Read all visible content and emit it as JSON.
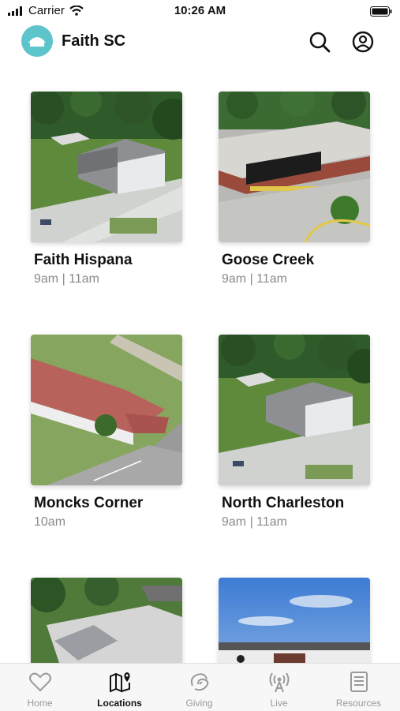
{
  "status_bar": {
    "carrier": "Carrier",
    "time": "10:26 AM"
  },
  "header": {
    "title": "Faith SC",
    "logo_icon": "church-logo-icon",
    "search_icon": "search-icon",
    "profile_icon": "profile-icon"
  },
  "locations": [
    {
      "name": "Faith Hispana",
      "times": "9am | 11am"
    },
    {
      "name": "Goose Creek",
      "times": "9am | 11am"
    },
    {
      "name": "Moncks Corner",
      "times": "10am"
    },
    {
      "name": "North Charleston",
      "times": "9am | 11am"
    },
    {
      "name": "",
      "times": ""
    },
    {
      "name": "",
      "times": ""
    }
  ],
  "tabs": [
    {
      "label": "Home",
      "icon": "heart-icon"
    },
    {
      "label": "Locations",
      "icon": "map-pin-icon",
      "active": true
    },
    {
      "label": "Giving",
      "icon": "giving-icon"
    },
    {
      "label": "Live",
      "icon": "broadcast-icon"
    },
    {
      "label": "Resources",
      "icon": "book-icon"
    }
  ],
  "colors": {
    "accent": "#5ec4cc",
    "tab_inactive": "#9a9a9a",
    "tab_active": "#111111"
  }
}
